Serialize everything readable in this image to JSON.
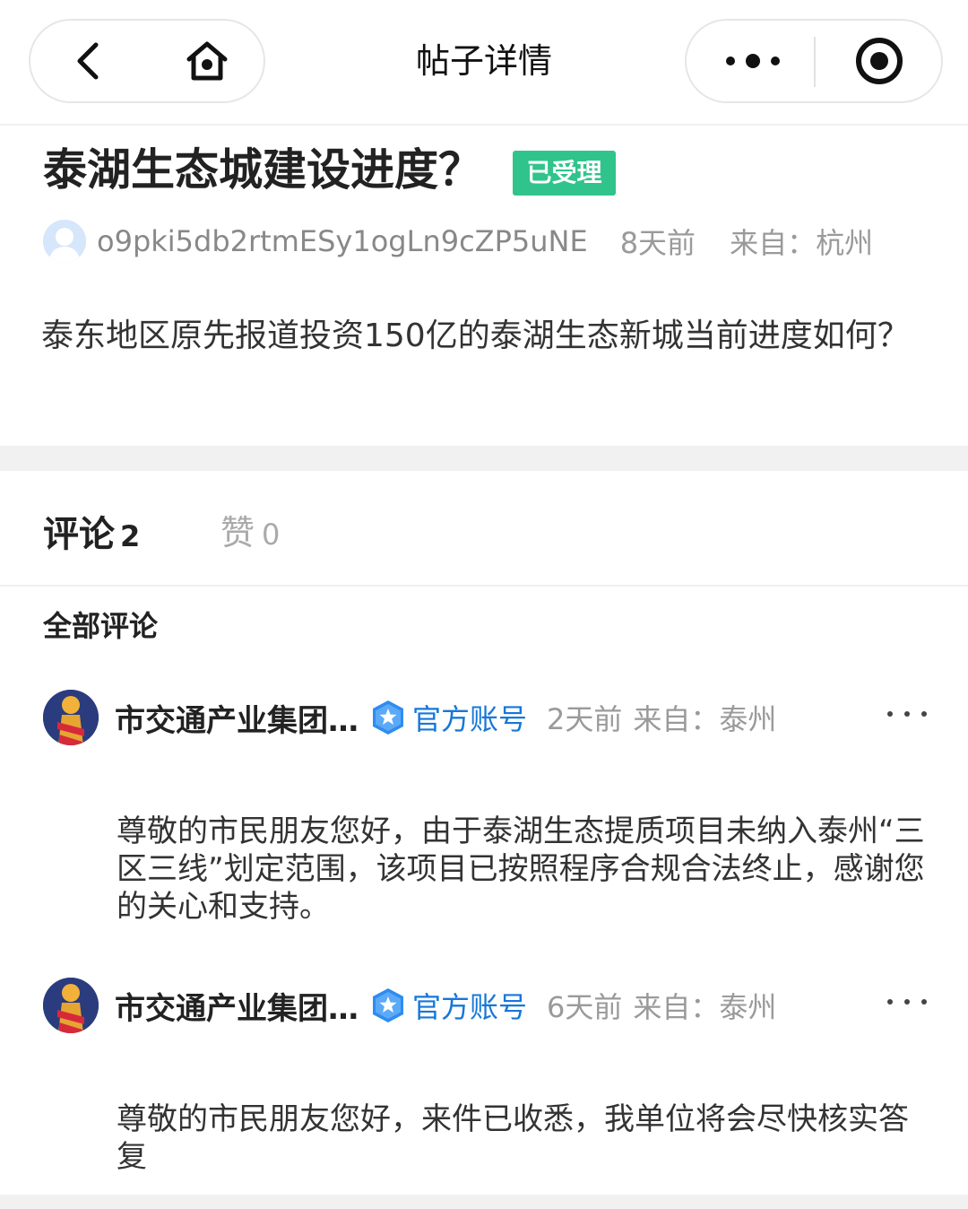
{
  "nav": {
    "title": "帖子详情",
    "back_icon": "chevron-left-icon",
    "home_icon": "home-icon",
    "more_icon": "more-dots-icon",
    "close_icon": "target-circle-icon"
  },
  "post": {
    "title": "泰湖生态城建设进度？",
    "status": "已受理",
    "status_color": "#30c48c",
    "author": "o9pki5db2rtmESy1ogLn9cZP5uNE",
    "time": "8天前",
    "location": "来自：杭州",
    "body": "泰东地区原先报道投资150亿的泰湖生态新城当前进度如何？"
  },
  "tabs": {
    "comments_label": "评论",
    "comments_count": "2",
    "likes_label": "赞",
    "likes_count": "0"
  },
  "section_heading": "全部评论",
  "comments": [
    {
      "author": "市交通产业集团…",
      "verified_label": "官方账号",
      "time": "2天前",
      "location": "来自：泰州",
      "body": "尊敬的市民朋友您好，由于泰湖生态提质项目未纳入泰州“三区三线”划定范围，该项目已按照程序合规合法终止，感谢您的关心和支持。"
    },
    {
      "author": "市交通产业集团…",
      "verified_label": "官方账号",
      "time": "6天前",
      "location": "来自：泰州",
      "body": "尊敬的市民朋友您好，来件已收悉，我单位将会尽快核实答复"
    }
  ],
  "colors": {
    "accent_blue": "#1677d9",
    "badge_green": "#30c48c",
    "muted_text": "#9a9a9a"
  }
}
